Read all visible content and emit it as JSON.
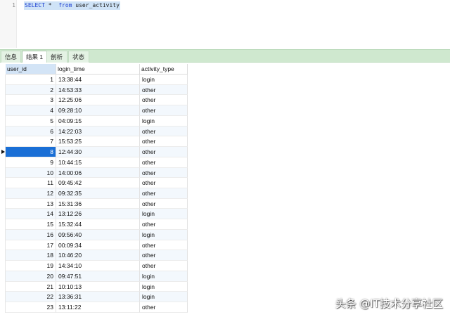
{
  "editor": {
    "line_number": "1",
    "keyword_select": "SELECT",
    "star": "*",
    "keyword_from": "from",
    "table_name": "user_activity"
  },
  "tabs": [
    {
      "label": "信息",
      "active": false
    },
    {
      "label": "结果 1",
      "active": true
    },
    {
      "label": "剖析",
      "active": false
    },
    {
      "label": "状态",
      "active": false
    }
  ],
  "grid": {
    "columns": [
      "user_id",
      "login_time",
      "activity_type"
    ],
    "selected_row_index": 7,
    "rows": [
      [
        "1",
        "13:38:44",
        "login"
      ],
      [
        "2",
        "14:53:33",
        "other"
      ],
      [
        "3",
        "12:25:06",
        "other"
      ],
      [
        "4",
        "09:28:10",
        "other"
      ],
      [
        "5",
        "04:09:15",
        "login"
      ],
      [
        "6",
        "14:22:03",
        "other"
      ],
      [
        "7",
        "15:53:25",
        "other"
      ],
      [
        "8",
        "12:44:30",
        "other"
      ],
      [
        "9",
        "10:44:15",
        "other"
      ],
      [
        "10",
        "14:00:06",
        "other"
      ],
      [
        "11",
        "09:45:42",
        "other"
      ],
      [
        "12",
        "09:32:35",
        "other"
      ],
      [
        "13",
        "15:31:36",
        "other"
      ],
      [
        "14",
        "13:12:26",
        "login"
      ],
      [
        "15",
        "15:32:44",
        "other"
      ],
      [
        "16",
        "09:56:40",
        "login"
      ],
      [
        "17",
        "00:09:34",
        "other"
      ],
      [
        "18",
        "10:46:20",
        "other"
      ],
      [
        "19",
        "14:34:10",
        "other"
      ],
      [
        "20",
        "09:47:51",
        "login"
      ],
      [
        "21",
        "10:10:13",
        "login"
      ],
      [
        "22",
        "13:36:31",
        "login"
      ],
      [
        "23",
        "13:11:22",
        "other"
      ]
    ]
  },
  "watermark": "头条 @IT技术分享社区",
  "colors": {
    "selection": "#1a6fd6",
    "tabstrip": "#cfe8cf",
    "keyword": "#1c3fd1",
    "code_highlight": "#cfe3f7"
  }
}
